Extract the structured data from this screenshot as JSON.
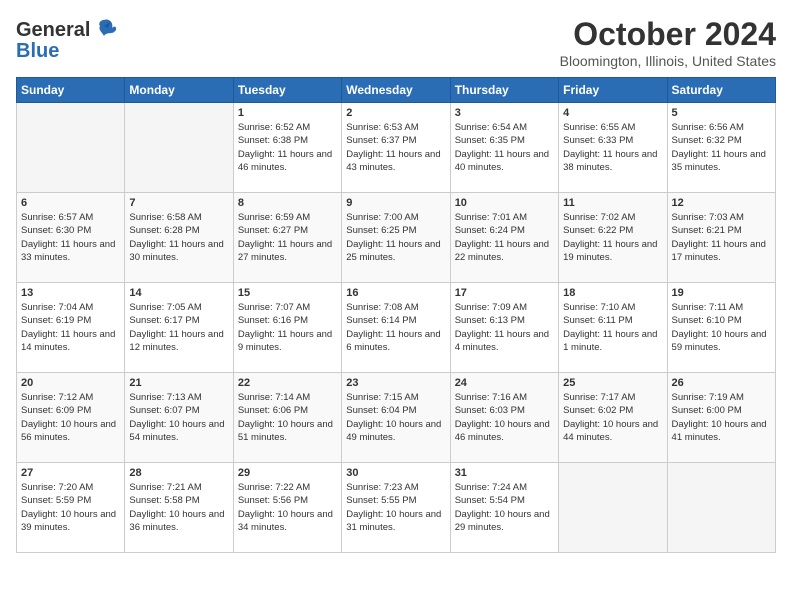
{
  "logo": {
    "line1": "General",
    "line2": "Blue"
  },
  "title": "October 2024",
  "subtitle": "Bloomington, Illinois, United States",
  "days_of_week": [
    "Sunday",
    "Monday",
    "Tuesday",
    "Wednesday",
    "Thursday",
    "Friday",
    "Saturday"
  ],
  "weeks": [
    [
      {
        "num": "",
        "info": ""
      },
      {
        "num": "",
        "info": ""
      },
      {
        "num": "1",
        "info": "Sunrise: 6:52 AM\nSunset: 6:38 PM\nDaylight: 11 hours and 46 minutes."
      },
      {
        "num": "2",
        "info": "Sunrise: 6:53 AM\nSunset: 6:37 PM\nDaylight: 11 hours and 43 minutes."
      },
      {
        "num": "3",
        "info": "Sunrise: 6:54 AM\nSunset: 6:35 PM\nDaylight: 11 hours and 40 minutes."
      },
      {
        "num": "4",
        "info": "Sunrise: 6:55 AM\nSunset: 6:33 PM\nDaylight: 11 hours and 38 minutes."
      },
      {
        "num": "5",
        "info": "Sunrise: 6:56 AM\nSunset: 6:32 PM\nDaylight: 11 hours and 35 minutes."
      }
    ],
    [
      {
        "num": "6",
        "info": "Sunrise: 6:57 AM\nSunset: 6:30 PM\nDaylight: 11 hours and 33 minutes."
      },
      {
        "num": "7",
        "info": "Sunrise: 6:58 AM\nSunset: 6:28 PM\nDaylight: 11 hours and 30 minutes."
      },
      {
        "num": "8",
        "info": "Sunrise: 6:59 AM\nSunset: 6:27 PM\nDaylight: 11 hours and 27 minutes."
      },
      {
        "num": "9",
        "info": "Sunrise: 7:00 AM\nSunset: 6:25 PM\nDaylight: 11 hours and 25 minutes."
      },
      {
        "num": "10",
        "info": "Sunrise: 7:01 AM\nSunset: 6:24 PM\nDaylight: 11 hours and 22 minutes."
      },
      {
        "num": "11",
        "info": "Sunrise: 7:02 AM\nSunset: 6:22 PM\nDaylight: 11 hours and 19 minutes."
      },
      {
        "num": "12",
        "info": "Sunrise: 7:03 AM\nSunset: 6:21 PM\nDaylight: 11 hours and 17 minutes."
      }
    ],
    [
      {
        "num": "13",
        "info": "Sunrise: 7:04 AM\nSunset: 6:19 PM\nDaylight: 11 hours and 14 minutes."
      },
      {
        "num": "14",
        "info": "Sunrise: 7:05 AM\nSunset: 6:17 PM\nDaylight: 11 hours and 12 minutes."
      },
      {
        "num": "15",
        "info": "Sunrise: 7:07 AM\nSunset: 6:16 PM\nDaylight: 11 hours and 9 minutes."
      },
      {
        "num": "16",
        "info": "Sunrise: 7:08 AM\nSunset: 6:14 PM\nDaylight: 11 hours and 6 minutes."
      },
      {
        "num": "17",
        "info": "Sunrise: 7:09 AM\nSunset: 6:13 PM\nDaylight: 11 hours and 4 minutes."
      },
      {
        "num": "18",
        "info": "Sunrise: 7:10 AM\nSunset: 6:11 PM\nDaylight: 11 hours and 1 minute."
      },
      {
        "num": "19",
        "info": "Sunrise: 7:11 AM\nSunset: 6:10 PM\nDaylight: 10 hours and 59 minutes."
      }
    ],
    [
      {
        "num": "20",
        "info": "Sunrise: 7:12 AM\nSunset: 6:09 PM\nDaylight: 10 hours and 56 minutes."
      },
      {
        "num": "21",
        "info": "Sunrise: 7:13 AM\nSunset: 6:07 PM\nDaylight: 10 hours and 54 minutes."
      },
      {
        "num": "22",
        "info": "Sunrise: 7:14 AM\nSunset: 6:06 PM\nDaylight: 10 hours and 51 minutes."
      },
      {
        "num": "23",
        "info": "Sunrise: 7:15 AM\nSunset: 6:04 PM\nDaylight: 10 hours and 49 minutes."
      },
      {
        "num": "24",
        "info": "Sunrise: 7:16 AM\nSunset: 6:03 PM\nDaylight: 10 hours and 46 minutes."
      },
      {
        "num": "25",
        "info": "Sunrise: 7:17 AM\nSunset: 6:02 PM\nDaylight: 10 hours and 44 minutes."
      },
      {
        "num": "26",
        "info": "Sunrise: 7:19 AM\nSunset: 6:00 PM\nDaylight: 10 hours and 41 minutes."
      }
    ],
    [
      {
        "num": "27",
        "info": "Sunrise: 7:20 AM\nSunset: 5:59 PM\nDaylight: 10 hours and 39 minutes."
      },
      {
        "num": "28",
        "info": "Sunrise: 7:21 AM\nSunset: 5:58 PM\nDaylight: 10 hours and 36 minutes."
      },
      {
        "num": "29",
        "info": "Sunrise: 7:22 AM\nSunset: 5:56 PM\nDaylight: 10 hours and 34 minutes."
      },
      {
        "num": "30",
        "info": "Sunrise: 7:23 AM\nSunset: 5:55 PM\nDaylight: 10 hours and 31 minutes."
      },
      {
        "num": "31",
        "info": "Sunrise: 7:24 AM\nSunset: 5:54 PM\nDaylight: 10 hours and 29 minutes."
      },
      {
        "num": "",
        "info": ""
      },
      {
        "num": "",
        "info": ""
      }
    ]
  ],
  "empty_indices": {
    "week0": [
      0,
      1
    ],
    "week4": [
      5,
      6
    ]
  }
}
